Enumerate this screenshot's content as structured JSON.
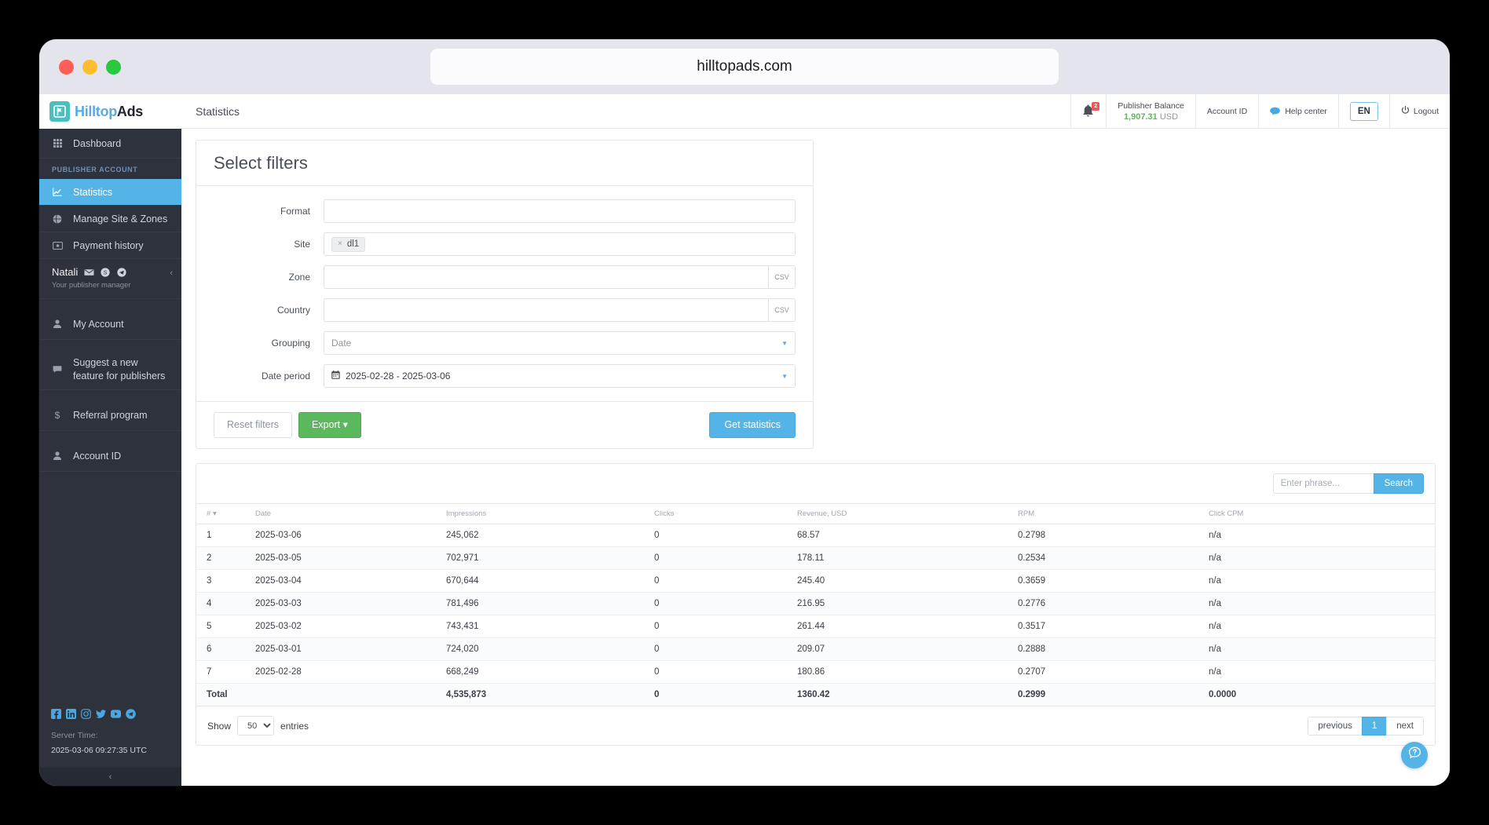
{
  "browser": {
    "url": "hilltopads.com"
  },
  "brand": {
    "part1": "Hilltop",
    "part2": "Ads"
  },
  "sidebar": {
    "dashboard": "Dashboard",
    "section_label": "PUBLISHER ACCOUNT",
    "items": [
      {
        "label": "Statistics",
        "icon": "chart-line-icon",
        "active": true
      },
      {
        "label": "Manage Site & Zones",
        "icon": "globe-icon",
        "active": false
      },
      {
        "label": "Payment history",
        "icon": "money-icon",
        "active": false
      }
    ],
    "manager": {
      "name": "Natali",
      "subtitle": "Your publisher manager"
    },
    "lower_items": [
      {
        "label": "My Account",
        "icon": "user-icon"
      },
      {
        "label": "Suggest a new feature for publishers",
        "icon": "comment-icon"
      },
      {
        "label": "Referral program",
        "icon": "dollar-icon"
      },
      {
        "label": "Account ID",
        "icon": "user-icon"
      }
    ],
    "server_time_label": "Server Time:",
    "server_time_value": "2025-03-06 09:27:35 UTC",
    "socials": [
      "facebook-icon",
      "linkedin-icon",
      "instagram-icon",
      "twitter-icon",
      "youtube-icon",
      "telegram-icon"
    ]
  },
  "topbar": {
    "title": "Statistics",
    "notifications_count": "2",
    "balance_label": "Publisher Balance",
    "balance_amount": "1,907.31",
    "balance_currency": "USD",
    "account_id": "Account ID",
    "help_center": "Help center",
    "language": "EN",
    "logout": "Logout"
  },
  "filters": {
    "title": "Select filters",
    "format": {
      "label": "Format",
      "value": ""
    },
    "site": {
      "label": "Site",
      "tag": "dl1",
      "remove": "×"
    },
    "zone": {
      "label": "Zone",
      "value": "",
      "addon": "CSV"
    },
    "country": {
      "label": "Country",
      "value": "",
      "addon": "CSV"
    },
    "grouping": {
      "label": "Grouping",
      "value": "Date"
    },
    "date_period": {
      "label": "Date period",
      "value": "2025-02-28 - 2025-03-06"
    },
    "reset": "Reset filters",
    "export": "Export",
    "get_statistics": "Get statistics"
  },
  "search": {
    "placeholder": "Enter phrase...",
    "value": "",
    "button": "Search"
  },
  "table": {
    "headers": [
      "#",
      "Date",
      "Impressions",
      "Clicks",
      "Revenue, USD",
      "RPM",
      "Click CPM"
    ],
    "sort_indicator": "▾",
    "rows": [
      [
        "1",
        "2025-03-06",
        "245,062",
        "0",
        "68.57",
        "0.2798",
        "n/a"
      ],
      [
        "2",
        "2025-03-05",
        "702,971",
        "0",
        "178.11",
        "0.2534",
        "n/a"
      ],
      [
        "3",
        "2025-03-04",
        "670,644",
        "0",
        "245.40",
        "0.3659",
        "n/a"
      ],
      [
        "4",
        "2025-03-03",
        "781,496",
        "0",
        "216.95",
        "0.2776",
        "n/a"
      ],
      [
        "5",
        "2025-03-02",
        "743,431",
        "0",
        "261.44",
        "0.3517",
        "n/a"
      ],
      [
        "6",
        "2025-03-01",
        "724,020",
        "0",
        "209.07",
        "0.2888",
        "n/a"
      ],
      [
        "7",
        "2025-02-28",
        "668,249",
        "0",
        "180.86",
        "0.2707",
        "n/a"
      ]
    ],
    "total": [
      "Total",
      "",
      "4,535,873",
      "0",
      "1360.42",
      "0.2999",
      "0.0000"
    ]
  },
  "footer": {
    "show": "Show",
    "entries_value": "50",
    "entries": "entries",
    "previous": "previous",
    "page": "1",
    "next": "next"
  }
}
